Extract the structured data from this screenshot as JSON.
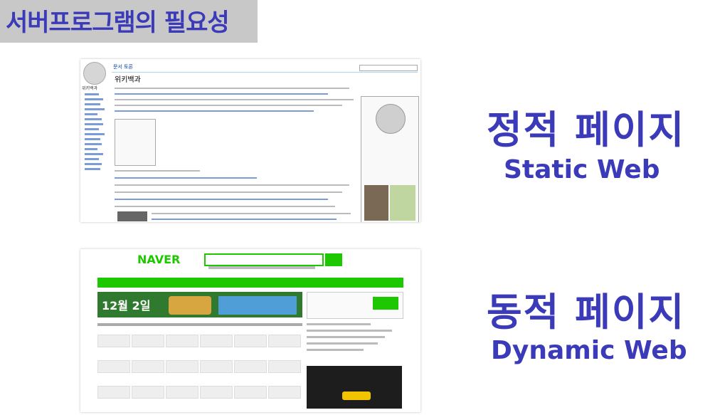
{
  "header": {
    "title": "서버프로그램의 필요성"
  },
  "static_section": {
    "label_ko": "정적 페이지",
    "label_en": "Static Web",
    "screenshot": {
      "site_logo_text": "위키백과",
      "heading": "위키백과",
      "tab_text": "문서 토론"
    }
  },
  "dynamic_section": {
    "label_ko": "동적 페이지",
    "label_en": "Dynamic Web",
    "screenshot": {
      "site_logo_text": "NAVER",
      "banner_text": "12월 2일"
    }
  },
  "colors": {
    "accent": "#3b3ab8",
    "naver_green": "#1ec800",
    "title_bg": "#c8c8c8"
  }
}
